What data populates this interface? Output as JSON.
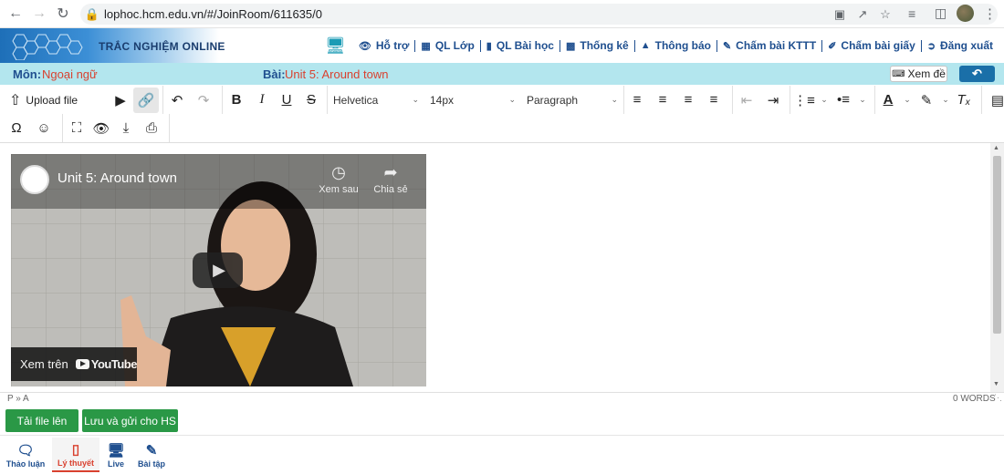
{
  "browser": {
    "url": "lophoc.hcm.edu.vn/#/JoinRoom/611635/0"
  },
  "app": {
    "logo_text": "TRẮC NGHIỆM ONLINE",
    "nav": [
      {
        "label": "Hỗ trợ",
        "icon": "eye-icon"
      },
      {
        "label": "QL Lớp",
        "icon": "grid-icon"
      },
      {
        "label": "QL Bài học",
        "icon": "book-icon"
      },
      {
        "label": "Thống kê",
        "icon": "bar-chart-icon"
      },
      {
        "label": "Thông báo",
        "icon": "bell-icon"
      },
      {
        "label": "Chấm bài KTTT",
        "icon": "edit-icon"
      },
      {
        "label": "Chấm bài giấy",
        "icon": "pencil-icon"
      },
      {
        "label": "Đăng xuất",
        "icon": "logout-icon"
      }
    ]
  },
  "subject": {
    "mon_label": "Môn:",
    "mon_value": "Ngoại ngữ",
    "bai_label": "Bài:",
    "bai_value": "Unit 5: Around town",
    "view_button": "Xem đề"
  },
  "toolbar": {
    "upload_label": "Upload file",
    "font_family": "Helvetica",
    "font_size": "14px",
    "block_format": "Paragraph"
  },
  "video": {
    "title": "Unit 5: Around town",
    "watch_later": "Xem sau",
    "share": "Chia sẻ",
    "watch_on": "Xem trên",
    "youtube": "YouTube"
  },
  "status": {
    "path": "P » A",
    "word_count": "0 WORDS"
  },
  "actions": {
    "upload": "Tải file lên",
    "save_send": "Lưu và gửi cho HS"
  },
  "bottom_tabs": [
    {
      "label": "Thảo luận",
      "icon": "chat-icon",
      "active": false
    },
    {
      "label": "Lý thuyết",
      "icon": "tablet-icon",
      "active": true
    },
    {
      "label": "Live",
      "icon": "monitor-icon",
      "active": false
    },
    {
      "label": "Bài tập",
      "icon": "edit-icon",
      "active": false
    }
  ]
}
